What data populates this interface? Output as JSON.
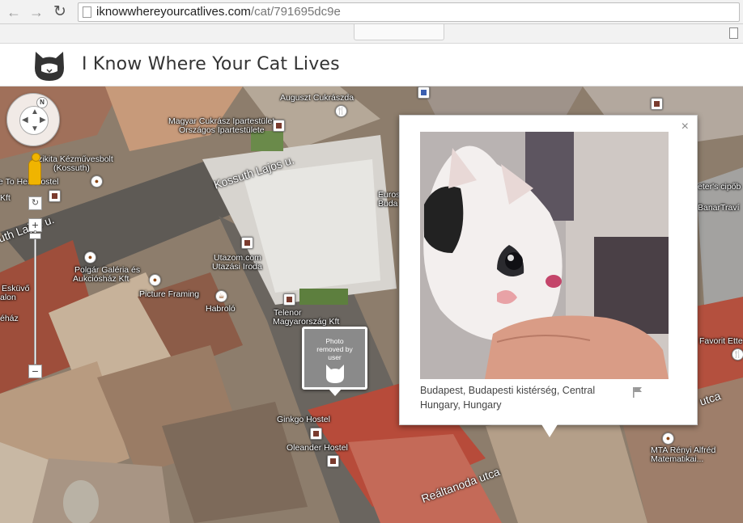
{
  "browser": {
    "url_domain": "iknowwhereyourcatlives.com",
    "url_path": "/cat/791695dc9e",
    "back_icon": "back-arrow-icon",
    "forward_icon": "forward-arrow-icon",
    "reload_icon": "reload-icon"
  },
  "header": {
    "title": "I Know Where Your Cat Lives",
    "logo_icon": "cat-head-icon"
  },
  "map": {
    "controls": {
      "compass_label": "N",
      "zoom_in": "+",
      "zoom_out": "−"
    },
    "streets": [
      {
        "id": "kossuth",
        "text": "Kossuth Lajos u."
      },
      {
        "id": "utca-left",
        "text": "uth Lajos u."
      },
      {
        "id": "realtanoda",
        "text": "Reáltanoda utca"
      },
      {
        "id": "utca-right",
        "text": "utca"
      }
    ],
    "places": [
      {
        "id": "augusztcukraszda",
        "text": "Auguszt Cukrászda"
      },
      {
        "id": "magyarcukrasz",
        "text": "Magyar Cukrász Ipartestület"
      },
      {
        "id": "magyarcukrasz2",
        "text": "Országos Ipartestülete"
      },
      {
        "id": "kitakezmuves",
        "text": "Szikita Kézművesbolt"
      },
      {
        "id": "kossuthpar",
        "text": "(Kossuth)"
      },
      {
        "id": "hostel-left",
        "text": "e To Hen Hostel"
      },
      {
        "id": "kft-left",
        "text": "Kft"
      },
      {
        "id": "polgar1",
        "text": "Polgár Galéria és"
      },
      {
        "id": "polgar2",
        "text": "Aukciósház Kft"
      },
      {
        "id": "picture",
        "text": "Picture Framing"
      },
      {
        "id": "habrolo",
        "text": "Habroló"
      },
      {
        "id": "utazom1",
        "text": "Utazom.com"
      },
      {
        "id": "utazom2",
        "text": "Utazási Iroda"
      },
      {
        "id": "telenor1",
        "text": "Telenor"
      },
      {
        "id": "telenor2",
        "text": "Magyarország Kft"
      },
      {
        "id": "eskuvo",
        "text": "Esküvő"
      },
      {
        "id": "alon",
        "text": "alon"
      },
      {
        "id": "ehaz",
        "text": "éház"
      },
      {
        "id": "ginkgo",
        "text": "Ginkgo Hostel"
      },
      {
        "id": "oleander",
        "text": "Oleander Hostel"
      },
      {
        "id": "euros",
        "text": "Euros"
      },
      {
        "id": "buda",
        "text": "Buda"
      },
      {
        "id": "peters",
        "text": "eter's cipőb"
      },
      {
        "id": "banar",
        "text": "BanarTraví"
      },
      {
        "id": "favorit",
        "text": "Favorit Ette"
      },
      {
        "id": "mta1",
        "text": "MTA Rényi Alfréd"
      },
      {
        "id": "mta2",
        "text": "Matematikai..."
      }
    ],
    "photo_removed_marker": {
      "text": "Photo removed by user",
      "icon": "cat-silhouette-icon"
    }
  },
  "info_window": {
    "close_label": "×",
    "location": "Budapest, Budapesti kistérség, Central Hungary, Hungary",
    "flag_icon": "flag-icon",
    "photo_subject": "black and white kitten held in a hand"
  },
  "colors": {
    "marker_gray": "#8a8a8a",
    "title_text": "#333333",
    "pegman": "#f0b400"
  }
}
